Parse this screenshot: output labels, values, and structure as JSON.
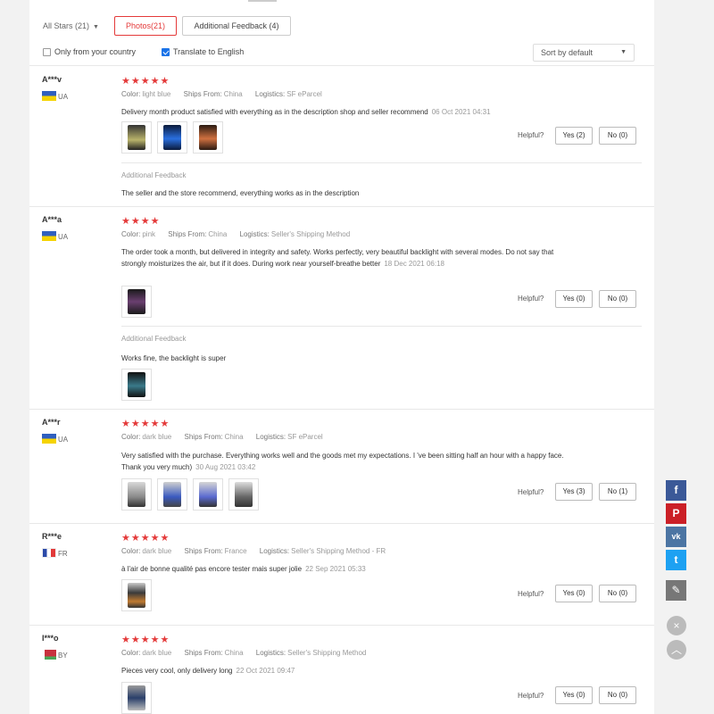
{
  "filters": {
    "all_stars": "All Stars (21)",
    "photos": "Photos(21)",
    "additional": "Additional Feedback (4)",
    "only_country": "Only from your country",
    "translate": "Translate to English",
    "sort": "Sort by default"
  },
  "labels": {
    "color": "Color:",
    "ships_from": "Ships From:",
    "logistics": "Logistics:",
    "helpful": "Helpful?",
    "additional_feedback": "Additional Feedback"
  },
  "reviews": [
    {
      "user": "A***v",
      "country": "UA",
      "stars": "★★★★★",
      "color": "light blue",
      "ships_from": "China",
      "logistics": "SF eParcel",
      "text": "Delivery month product satisfied with everything as in the description shop and seller recommend",
      "date": "06 Oct 2021 04:31",
      "yes": "Yes (2)",
      "no": "No (0)",
      "additional_text": "The seller and the store recommend, everything works as in the description"
    },
    {
      "user": "A***a",
      "country": "UA",
      "stars": "★★★★",
      "color": "pink",
      "ships_from": "China",
      "logistics": "Seller's Shipping Method",
      "text": "The order took a month, but delivered in integrity and safety. Works perfectly, very beautiful backlight with several modes. Do not say that strongly moisturizes the air, but if it does. During work near yourself-breathe better",
      "date": "18 Dec 2021 06:18",
      "yes": "Yes (0)",
      "no": "No (0)",
      "additional_text": "Works fine, the backlight is super"
    },
    {
      "user": "A***r",
      "country": "UA",
      "stars": "★★★★★",
      "color": "dark blue",
      "ships_from": "China",
      "logistics": "SF eParcel",
      "text": "Very satisfied with the purchase. Everything works well and the goods met my expectations. I 've been sitting half an hour with a happy face. Thank you very much)",
      "date": "30 Aug 2021 03:42",
      "yes": "Yes (3)",
      "no": "No (1)"
    },
    {
      "user": "R***e",
      "country": "FR",
      "stars": "★★★★★",
      "color": "dark blue",
      "ships_from": "France",
      "logistics": "Seller's Shipping Method - FR",
      "text": "à l'air de bonne qualité pas encore tester mais super jolie",
      "date": "22 Sep 2021 05:33",
      "yes": "Yes (0)",
      "no": "No (0)"
    },
    {
      "user": "I***o",
      "country": "BY",
      "stars": "★★★★★",
      "color": "dark blue",
      "ships_from": "China",
      "logistics": "Seller's Shipping Method",
      "text": "Pieces very cool, only delivery long",
      "date": "22 Oct 2021 09:47",
      "yes": "Yes (0)",
      "no": "No (0)"
    }
  ],
  "social": {
    "facebook": "f",
    "pinterest": "P",
    "vk": "vk",
    "twitter": "t",
    "edit": "✎",
    "close": "×",
    "up": "︿"
  },
  "colors": {
    "accent": "#e43a3a",
    "facebook": "#3b5998",
    "pinterest": "#cb2027",
    "vk": "#4c75a3",
    "twitter": "#1da1f2",
    "edit": "#777777"
  }
}
